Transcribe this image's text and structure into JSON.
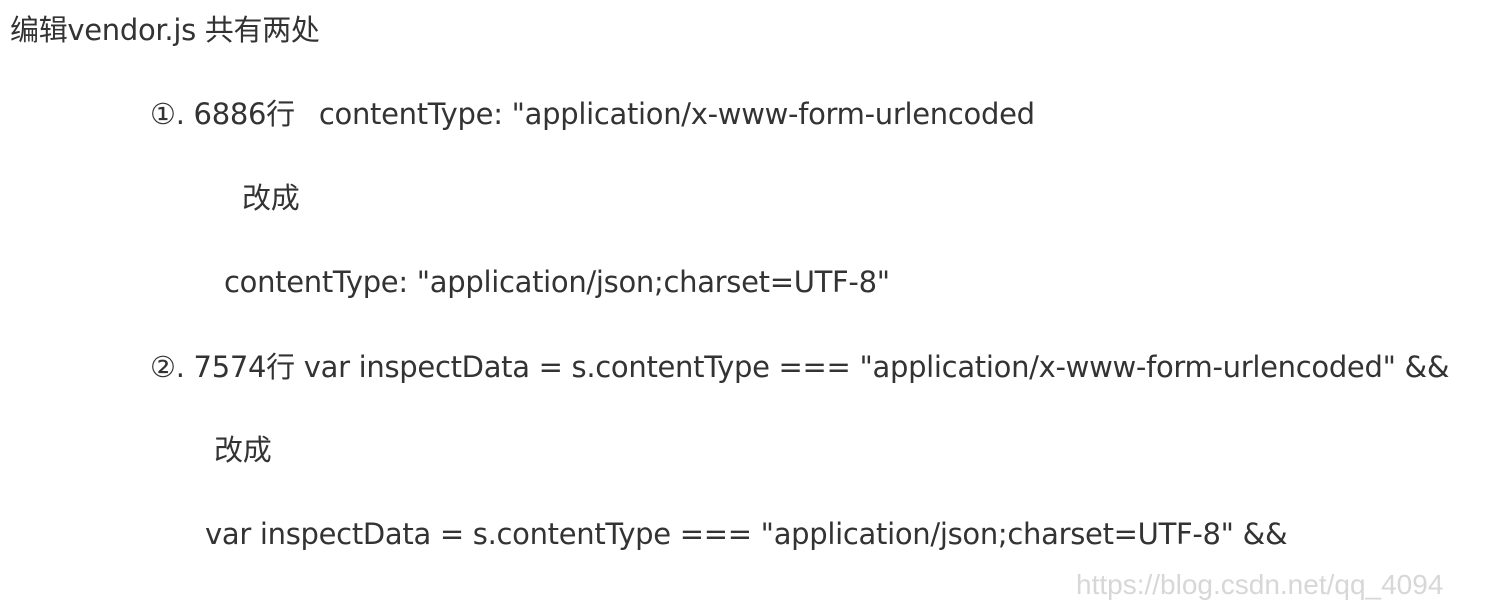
{
  "title": "编辑vendor.js  共有两处",
  "items": [
    {
      "marker": "①.",
      "line_label": "6886行",
      "original": "contentType: \"application/x-www-form-urlencoded",
      "change_word": "改成",
      "replacement": "contentType: \"application/json;charset=UTF-8\""
    },
    {
      "marker": "②.",
      "line_label": "7574行",
      "original": "var inspectData = s.contentType === \"application/x-www-form-urlencoded\" &&",
      "change_word": "改成",
      "replacement": "var inspectData = s.contentType === \"application/json;charset=UTF-8\" &&"
    }
  ],
  "watermark": "https://blog.csdn.net/qq_4094"
}
